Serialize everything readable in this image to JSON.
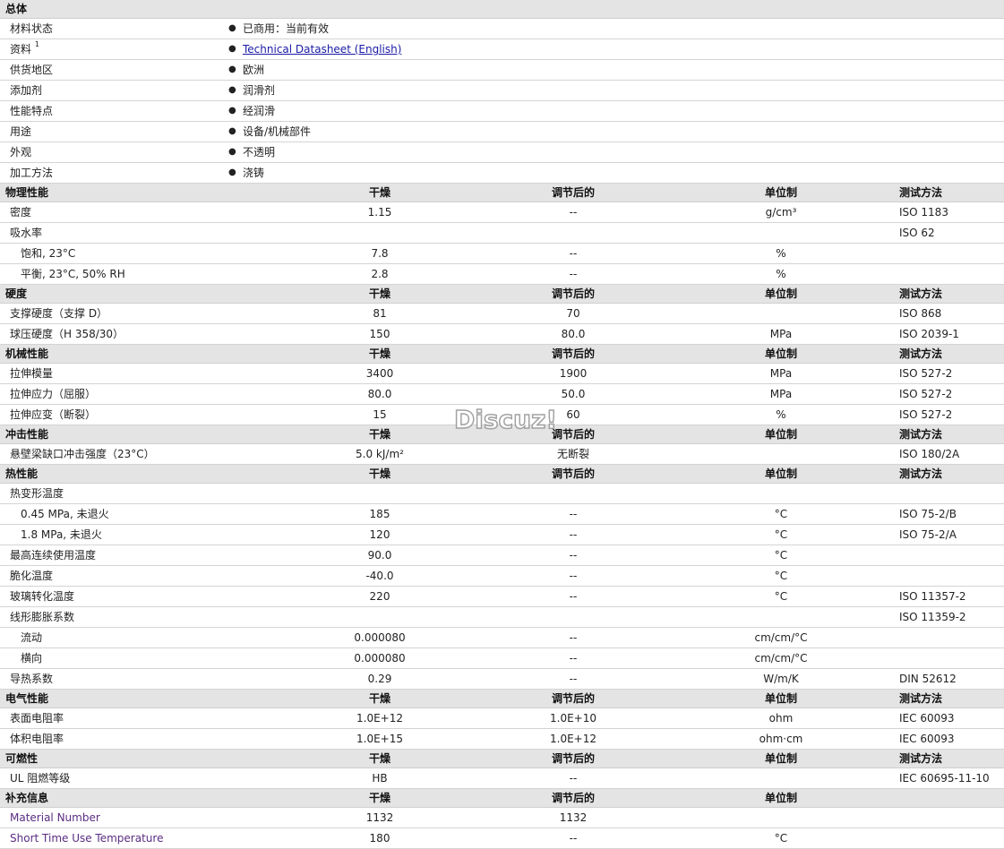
{
  "general": {
    "title": "总体",
    "rows": [
      {
        "label": "材料状态",
        "value": "已商用：当前有效"
      },
      {
        "label": "资料",
        "sup": "1",
        "value": "Technical Datasheet (English)",
        "link": true
      },
      {
        "label": "供货地区",
        "value": "欧洲"
      },
      {
        "label": "添加剂",
        "value": "润滑剂"
      },
      {
        "label": "性能特点",
        "value": "经润滑"
      },
      {
        "label": "用途",
        "value": "设备/机械部件"
      },
      {
        "label": "外观",
        "value": "不透明"
      },
      {
        "label": "加工方法",
        "value": "浇铸"
      }
    ]
  },
  "columns": {
    "dry": "干燥",
    "cond": "调节后的",
    "unit": "单位制",
    "test": "测试方法"
  },
  "sections": [
    {
      "title": "物理性能",
      "rows": [
        {
          "label": "密度",
          "dry": "1.15",
          "cond": "--",
          "unit": "g/cm³",
          "test": "ISO 1183"
        },
        {
          "label": "吸水率",
          "dry": "",
          "cond": "",
          "unit": "",
          "test": "ISO 62"
        },
        {
          "label": "饱和, 23°C",
          "indent": true,
          "dry": "7.8",
          "cond": "--",
          "unit": "%",
          "test": ""
        },
        {
          "label": "平衡, 23°C, 50% RH",
          "indent": true,
          "dry": "2.8",
          "cond": "--",
          "unit": "%",
          "test": ""
        }
      ]
    },
    {
      "title": "硬度",
      "rows": [
        {
          "label": "支撑硬度（支撑 D）",
          "dry": "81",
          "cond": "70",
          "unit": "",
          "test": "ISO 868"
        },
        {
          "label": "球压硬度（H 358/30）",
          "dry": "150",
          "cond": "80.0",
          "unit": "MPa",
          "test": "ISO 2039-1"
        }
      ]
    },
    {
      "title": "机械性能",
      "rows": [
        {
          "label": "拉伸模量",
          "dry": "3400",
          "cond": "1900",
          "unit": "MPa",
          "test": "ISO 527-2"
        },
        {
          "label": "拉伸应力（屈服）",
          "dry": "80.0",
          "cond": "50.0",
          "unit": "MPa",
          "test": "ISO 527-2"
        },
        {
          "label": "拉伸应变（断裂）",
          "dry": "15",
          "cond": "60",
          "unit": "%",
          "test": "ISO 527-2"
        }
      ]
    },
    {
      "title": "冲击性能",
      "rows": [
        {
          "label": "悬壁梁缺口冲击强度（23°C）",
          "dry": "5.0 kJ/m²",
          "cond": "无断裂",
          "unit": "",
          "test": "ISO 180/2A"
        }
      ]
    },
    {
      "title": "热性能",
      "rows": [
        {
          "label": "热变形温度",
          "dry": "",
          "cond": "",
          "unit": "",
          "test": ""
        },
        {
          "label": "0.45 MPa, 未退火",
          "indent": true,
          "dry": "185",
          "cond": "--",
          "unit": "°C",
          "test": "ISO 75-2/B"
        },
        {
          "label": "1.8 MPa, 未退火",
          "indent": true,
          "dry": "120",
          "cond": "--",
          "unit": "°C",
          "test": "ISO 75-2/A"
        },
        {
          "label": "最高连续使用温度",
          "dry": "90.0",
          "cond": "--",
          "unit": "°C",
          "test": ""
        },
        {
          "label": "脆化温度",
          "dry": "-40.0",
          "cond": "--",
          "unit": "°C",
          "test": ""
        },
        {
          "label": "玻璃转化温度",
          "dry": "220",
          "cond": "--",
          "unit": "°C",
          "test": "ISO 11357-2"
        },
        {
          "label": "线形膨胀系数",
          "dry": "",
          "cond": "",
          "unit": "",
          "test": "ISO 11359-2"
        },
        {
          "label": "流动",
          "indent": true,
          "dry": "0.000080",
          "cond": "--",
          "unit": "cm/cm/°C",
          "test": ""
        },
        {
          "label": "横向",
          "indent": true,
          "dry": "0.000080",
          "cond": "--",
          "unit": "cm/cm/°C",
          "test": ""
        },
        {
          "label": "导热系数",
          "dry": "0.29",
          "cond": "--",
          "unit": "W/m/K",
          "test": "DIN 52612"
        }
      ]
    },
    {
      "title": "电气性能",
      "rows": [
        {
          "label": "表面电阻率",
          "dry": "1.0E+12",
          "cond": "1.0E+10",
          "unit": "ohm",
          "test": "IEC 60093"
        },
        {
          "label": "体积电阻率",
          "dry": "1.0E+15",
          "cond": "1.0E+12",
          "unit": "ohm·cm",
          "test": "IEC 60093"
        }
      ]
    },
    {
      "title": "可燃性",
      "rows": [
        {
          "label": "UL 阻燃等级",
          "dry": "HB",
          "cond": "--",
          "unit": "",
          "test": "IEC 60695-11-10"
        }
      ]
    },
    {
      "title": "补充信息",
      "noTestHeader": true,
      "rows": [
        {
          "label": "Material Number",
          "purple": true,
          "dry": "1132",
          "cond": "1132",
          "unit": "",
          "test": ""
        },
        {
          "label": "Short Time Use Temperature",
          "purple": true,
          "dry": "180",
          "cond": "--",
          "unit": "°C",
          "test": ""
        }
      ]
    }
  ],
  "watermark": "Discuz!"
}
